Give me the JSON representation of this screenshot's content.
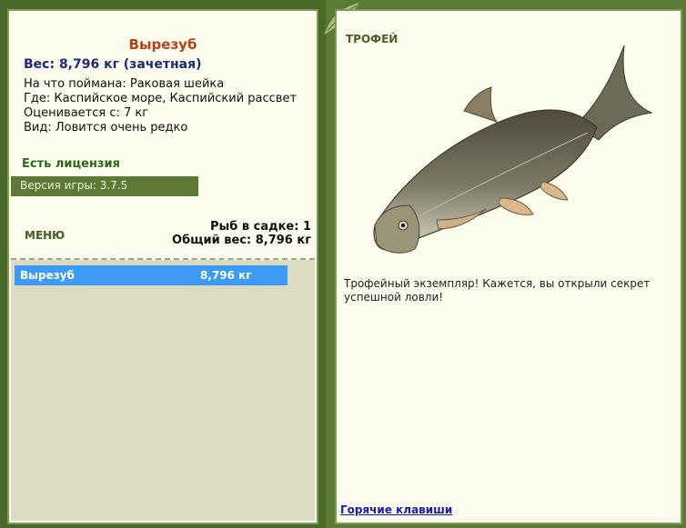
{
  "fish": {
    "name": "Вырезуб",
    "weight_line": "Вес: 8,796 кг (зачетная)",
    "bait_line": "На что поймана: Раковая шейка",
    "place_line": "Где: Каспийское море, Каспийский рассвет",
    "rating_line": "Оценивается с: 7 кг",
    "kind_line": "Вид: Ловится очень редко"
  },
  "license": "Есть лицензия",
  "version": "Версия игры: 3.7.5",
  "menu_label": "МЕНЮ",
  "stats": {
    "count_line": "Рыб в садке: 1",
    "total_line": "Общий вес: 8,796 кг"
  },
  "catch_list": [
    {
      "name": "Вырезуб",
      "weight": "8,796 кг"
    }
  ],
  "trophy": {
    "label": "ТРОФЕЙ",
    "text": "Трофейный экземпляр! Кажется, вы открыли секрет успешной ловли!"
  },
  "hotkeys_link": "Горячие клавиши"
}
